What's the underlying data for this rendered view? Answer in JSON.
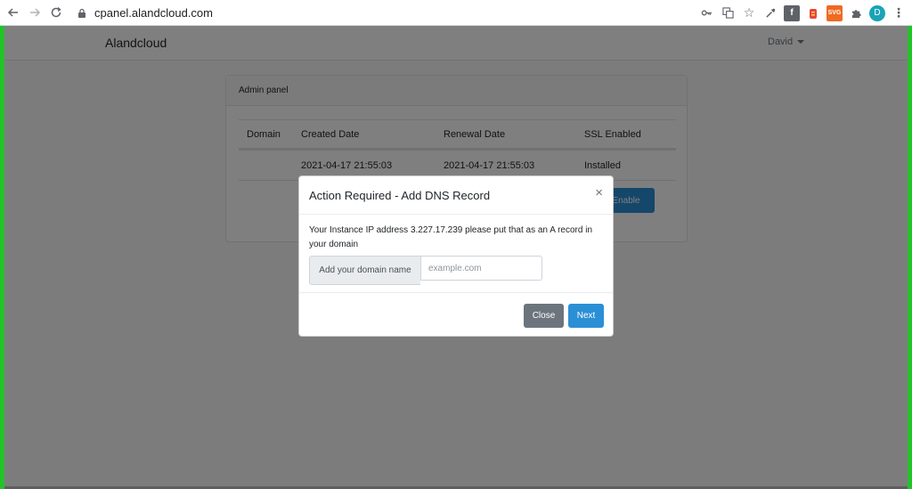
{
  "browser": {
    "url": "cpanel.alandcloud.com",
    "profile_initial": "D",
    "extension_badge": "SVG"
  },
  "app": {
    "brand": "Alandcloud",
    "user": "David"
  },
  "panel": {
    "title": "Admin panel",
    "columns": [
      "Domain",
      "Created Date",
      "Renewal Date",
      "SSL Enabled"
    ],
    "rows": [
      {
        "domain": "",
        "created": "2021-04-17 21:55:03",
        "renewal": "2021-04-17 21:55:03",
        "ssl": "Installed"
      }
    ],
    "enable_button": "Enable"
  },
  "modal": {
    "title": "Action Required - Add DNS Record",
    "close_symbol": "×",
    "message": "Your Instance IP address 3.227.17.239 please put that as an A record in your domain",
    "input_label": "Add your domain name",
    "input_placeholder": "example.com",
    "input_value": "",
    "close_button": "Close",
    "next_button": "Next"
  },
  "colors": {
    "primary": "#2b8fd6",
    "secondary": "#6c757d",
    "frame": "#22c32a"
  }
}
